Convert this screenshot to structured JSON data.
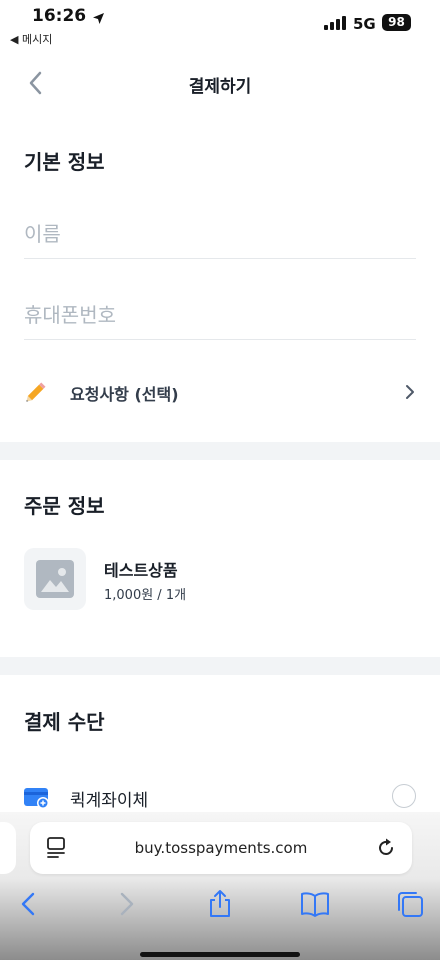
{
  "status_bar": {
    "time": "16:26",
    "back_app": "◀ 메시지",
    "network": "5G",
    "battery": "98"
  },
  "header": {
    "title": "결제하기"
  },
  "basic_info": {
    "title": "기본 정보",
    "name_placeholder": "이름",
    "phone_placeholder": "휴대폰번호",
    "request_label": "요청사항 (선택)"
  },
  "order_info": {
    "title": "주문 정보",
    "product_name": "테스트상품",
    "product_meta": "1,000원 / 1개"
  },
  "payment": {
    "title": "결제 수단",
    "option_label": "퀵계좌이체"
  },
  "browser": {
    "url": "buy.tosspayments.com"
  },
  "colors": {
    "accent": "#3182f6",
    "divider": "#f2f4f6",
    "text": "#191f28",
    "placeholder": "#b0b8c1"
  }
}
